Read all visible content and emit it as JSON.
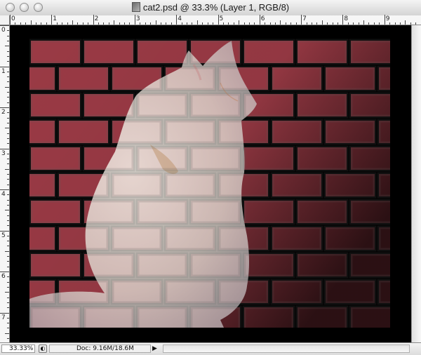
{
  "window": {
    "title": "cat2.psd @ 33.3% (Layer 1, RGB/8)"
  },
  "rulers": {
    "horizontal_labels": [
      "0",
      "1",
      "2",
      "3",
      "4",
      "5",
      "6",
      "7",
      "8",
      "9"
    ],
    "vertical_labels": [
      "0",
      "1",
      "2",
      "3",
      "4",
      "5",
      "6",
      "7"
    ]
  },
  "statusbar": {
    "zoom": "33.33%",
    "doc_size": "Doc: 9.16M/18.6M",
    "arrow": "▶"
  },
  "colors": {
    "brick": "#9a3a45",
    "mortar": "#000000",
    "fade": "#2a0a0e"
  },
  "icons": {
    "document": "psd-document-icon",
    "status": "status-info-icon"
  }
}
